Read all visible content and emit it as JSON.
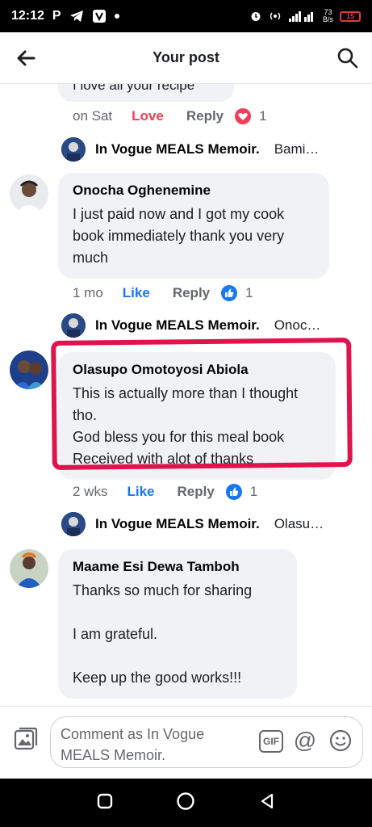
{
  "status_bar": {
    "time": "12:12",
    "carrier_letter": "P",
    "net_speed_value": "73",
    "net_speed_unit": "B/s",
    "battery": "15"
  },
  "header": {
    "title": "Your post"
  },
  "partial_comment": {
    "text": "I love all your recipe",
    "time": "on Sat",
    "reaction_label": "Love",
    "reply_label": "Reply",
    "reaction_count": "1",
    "reaction_icon": "love-icon"
  },
  "comments": [
    {
      "reply_name": "In Vogue MEALS Memoir.",
      "reply_preview": "Bami…"
    },
    {
      "name": "Onocha Oghenemine",
      "text_lines": [
        "I just paid now and I got my cook",
        "book immediately thank you very",
        "much"
      ],
      "time": "1 mo",
      "like_label": "Like",
      "reply_label": "Reply",
      "reaction_count": "1",
      "reply_name": "In Vogue MEALS Memoir.",
      "reply_preview": "Onoc…"
    },
    {
      "name": "Olasupo Omotoyosi Abiola",
      "text_lines": [
        "This is actually more than I thought",
        "tho.",
        "God bless you for this meal book",
        "Received with alot of thanks"
      ],
      "time": "2 wks",
      "like_label": "Like",
      "reply_label": "Reply",
      "reaction_count": "1",
      "reply_name": "In Vogue MEALS Memoir.",
      "reply_preview": "Olasu…"
    },
    {
      "name": "Maame Esi Dewa Tamboh",
      "text_lines": [
        "Thanks so much for sharing",
        "",
        "I am grateful.",
        "",
        "Keep up the good works!!!"
      ]
    }
  ],
  "composer": {
    "placeholder": "Comment as In Vogue MEALS Memoir.",
    "gif_label": "GIF",
    "at_label": "@"
  },
  "colors": {
    "like_blue": "#1877f2",
    "love_red": "#f33e58",
    "highlight": "#e0144c",
    "bubble": "#f0f2f5"
  }
}
